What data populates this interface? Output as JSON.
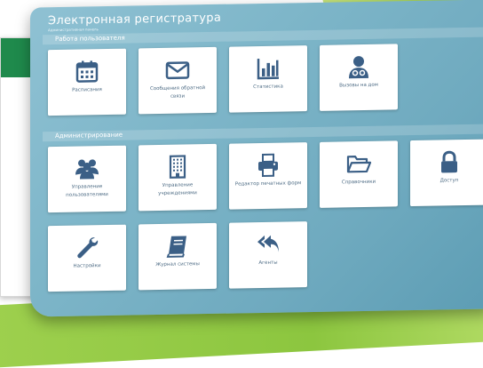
{
  "app": {
    "title": "Электронная регистратура",
    "subtitle": "Административная панель"
  },
  "bg_window": {
    "hints": [
      "",
      "",
      "",
      ""
    ],
    "accent_colors": {
      "green": "#1f8a4c",
      "red": "#d22222"
    }
  },
  "sections": [
    {
      "title": "Работа пользователя",
      "tiles": [
        {
          "id": "schedule",
          "label": "Расписания",
          "icon": "calendar-icon"
        },
        {
          "id": "feedback",
          "label": "Сообщения обратной связи",
          "icon": "envelope-icon"
        },
        {
          "id": "stats",
          "label": "Статистика",
          "icon": "bar-chart-icon"
        },
        {
          "id": "home-visit",
          "label": "Вызовы на дом",
          "icon": "doctor-icon"
        }
      ]
    },
    {
      "title": "Администрирование",
      "tiles": [
        {
          "id": "users",
          "label": "Управление пользователями",
          "icon": "users-icon"
        },
        {
          "id": "institutions",
          "label": "Управление учреждениями",
          "icon": "building-icon"
        },
        {
          "id": "print-editor",
          "label": "Редактор печатных форм",
          "icon": "printer-icon"
        },
        {
          "id": "dictionaries",
          "label": "Справочники",
          "icon": "folder-icon"
        },
        {
          "id": "access",
          "label": "Доступ",
          "icon": "lock-icon"
        },
        {
          "id": "settings",
          "label": "Настройки",
          "icon": "wrench-icon"
        },
        {
          "id": "system-log",
          "label": "Журнал системы",
          "icon": "book-icon"
        },
        {
          "id": "agents",
          "label": "Агенты",
          "icon": "reply-all-icon"
        }
      ]
    }
  ],
  "colors": {
    "icon": "#3b5f86",
    "tile_text": "#4d6b84",
    "stage": "#7eb6c9"
  }
}
